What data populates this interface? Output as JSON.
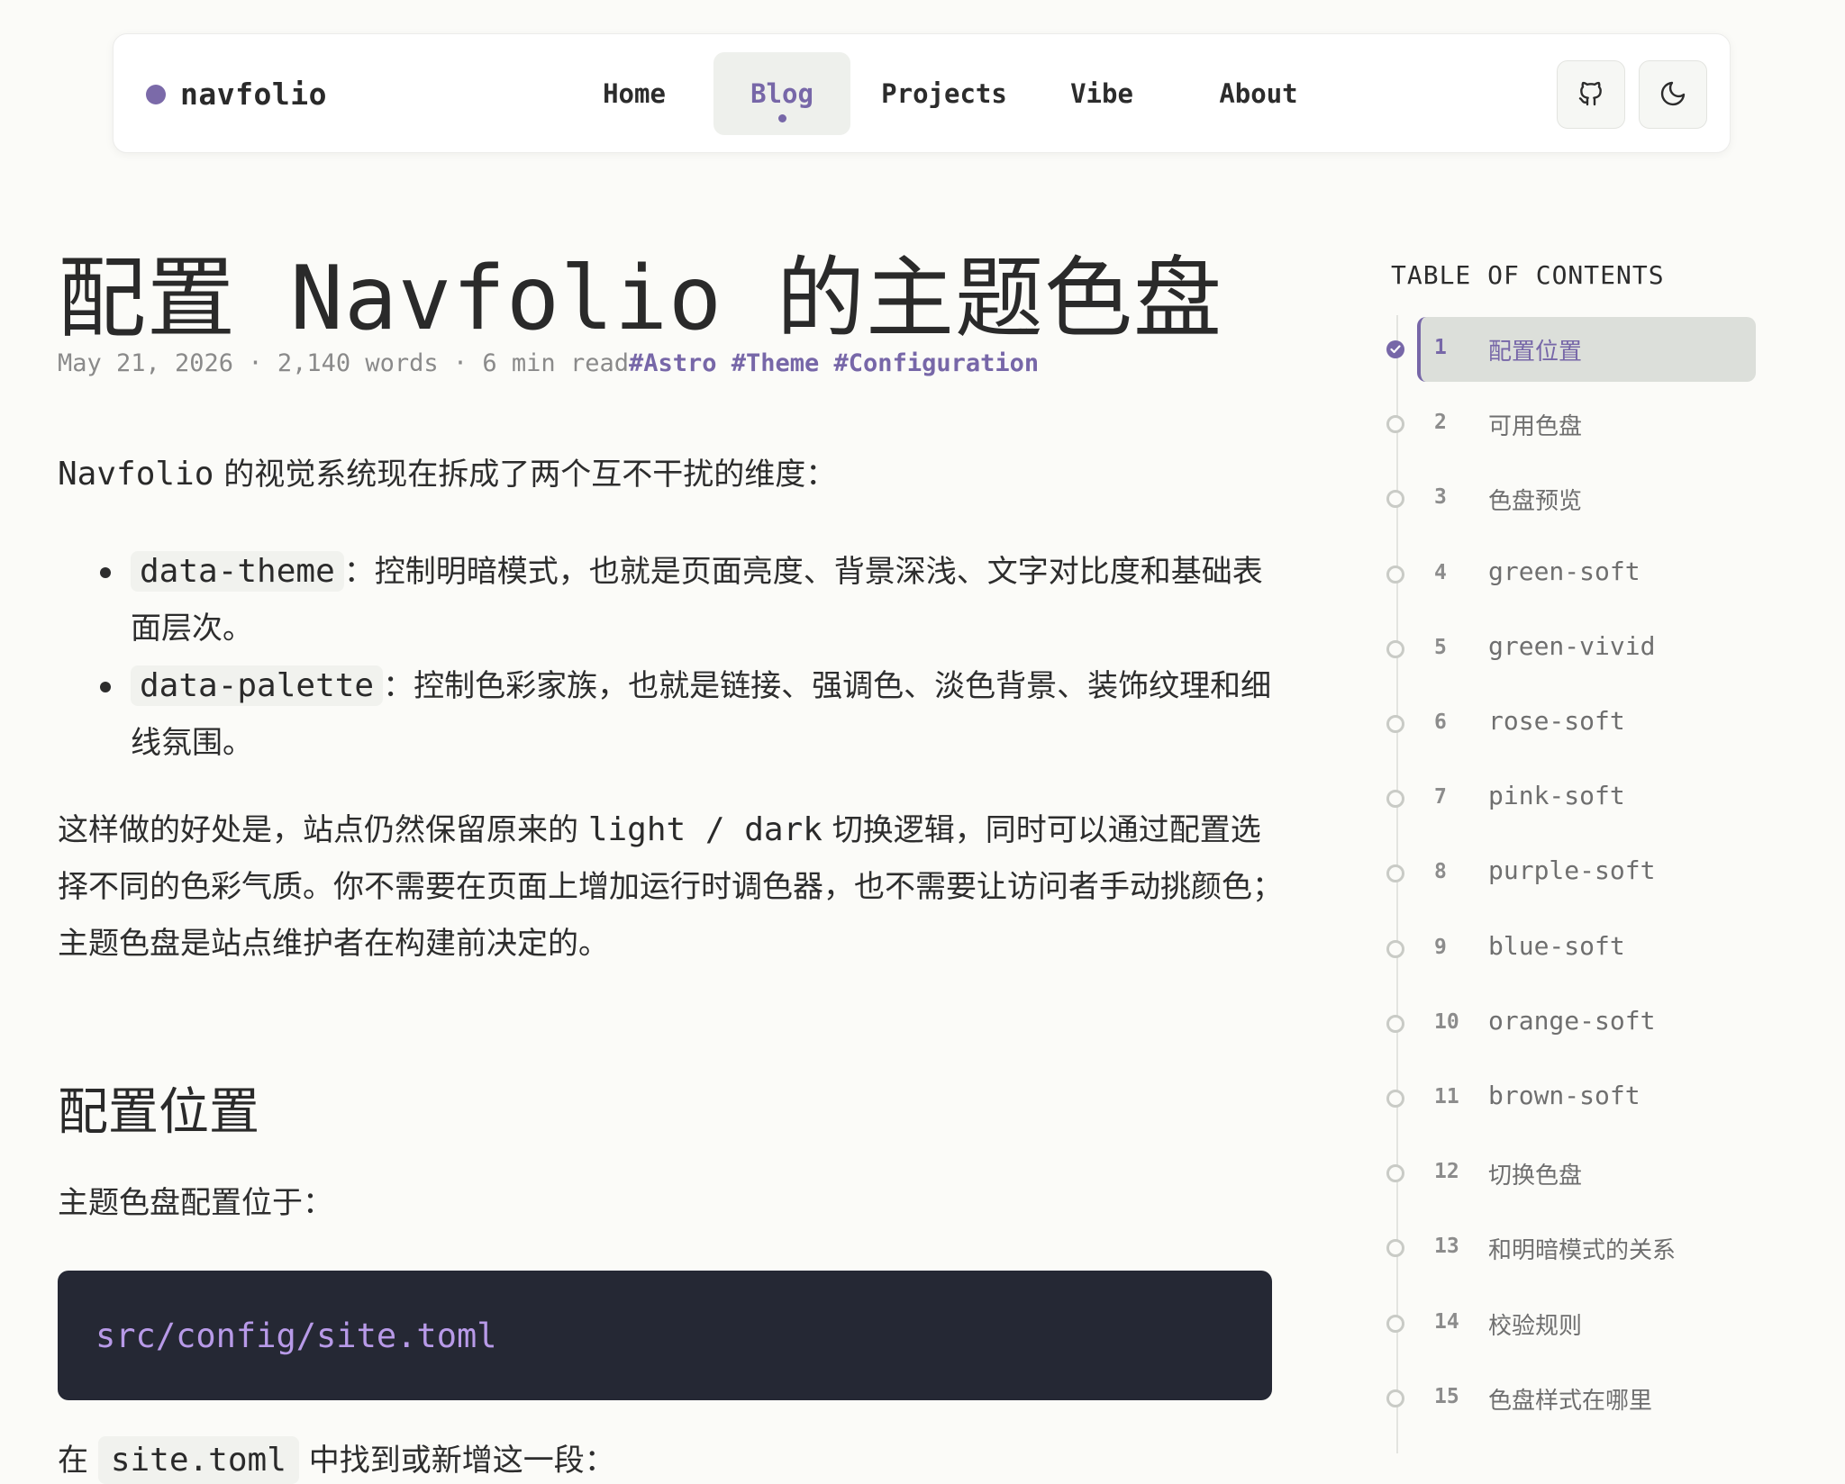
{
  "brand": {
    "name": "navfolio"
  },
  "nav": {
    "items": [
      {
        "label": "Home"
      },
      {
        "label": "Blog"
      },
      {
        "label": "Projects"
      },
      {
        "label": "Vibe"
      },
      {
        "label": "About"
      }
    ],
    "active": "Blog"
  },
  "header_icons": {
    "github": "github-icon",
    "theme": "moon-icon"
  },
  "article": {
    "title": "配置 Navfolio 的主题色盘",
    "meta": "May 21, 2026 · 2,140 words · 6 min read",
    "tags": "#Astro #Theme #Configuration",
    "intro_mono": "Navfolio",
    "intro_text": " 的视觉系统现在拆成了两个互不干扰的维度：",
    "bullets": [
      {
        "code": "data-theme",
        "text": "：控制明暗模式，也就是页面亮度、背景深浅、文字对比度和基础表面层次。"
      },
      {
        "code": "data-palette",
        "text": "：控制色彩家族，也就是链接、强调色、淡色背景、装饰纹理和细线氛围。"
      }
    ],
    "para2_a": "这样做的好处是，站点仍然保留原来的 ",
    "para2_mono": "light / dark",
    "para2_b": " 切换逻辑，同时可以通过配置选择不同的色彩气质。你不需要在页面上增加运行时调色器，也不需要让访问者手动挑颜色；主题色盘是站点维护者在构建前决定的。",
    "section_title": "配置位置",
    "section_text": "主题色盘配置位于：",
    "code_path": "src/config/site.toml",
    "cut_prefix": "在",
    "cut_code": "site.toml",
    "cut_text": " 中找到或新增这一段："
  },
  "toc": {
    "heading": "TABLE OF CONTENTS",
    "active_index": 0,
    "items": [
      {
        "num": "1",
        "label": "配置位置"
      },
      {
        "num": "2",
        "label": "可用色盘"
      },
      {
        "num": "3",
        "label": "色盘预览"
      },
      {
        "num": "4",
        "label": "green-soft"
      },
      {
        "num": "5",
        "label": "green-vivid"
      },
      {
        "num": "6",
        "label": "rose-soft"
      },
      {
        "num": "7",
        "label": "pink-soft"
      },
      {
        "num": "8",
        "label": "purple-soft"
      },
      {
        "num": "9",
        "label": "blue-soft"
      },
      {
        "num": "10",
        "label": "orange-soft"
      },
      {
        "num": "11",
        "label": "brown-soft"
      },
      {
        "num": "12",
        "label": "切换色盘"
      },
      {
        "num": "13",
        "label": "和明暗模式的关系"
      },
      {
        "num": "14",
        "label": "校验规则"
      },
      {
        "num": "15",
        "label": "色盘样式在哪里"
      }
    ]
  },
  "colors": {
    "accent": "#7767a8",
    "code_bg": "#252834",
    "code_text": "#b89ae8",
    "page_bg": "#fbfbf8"
  }
}
